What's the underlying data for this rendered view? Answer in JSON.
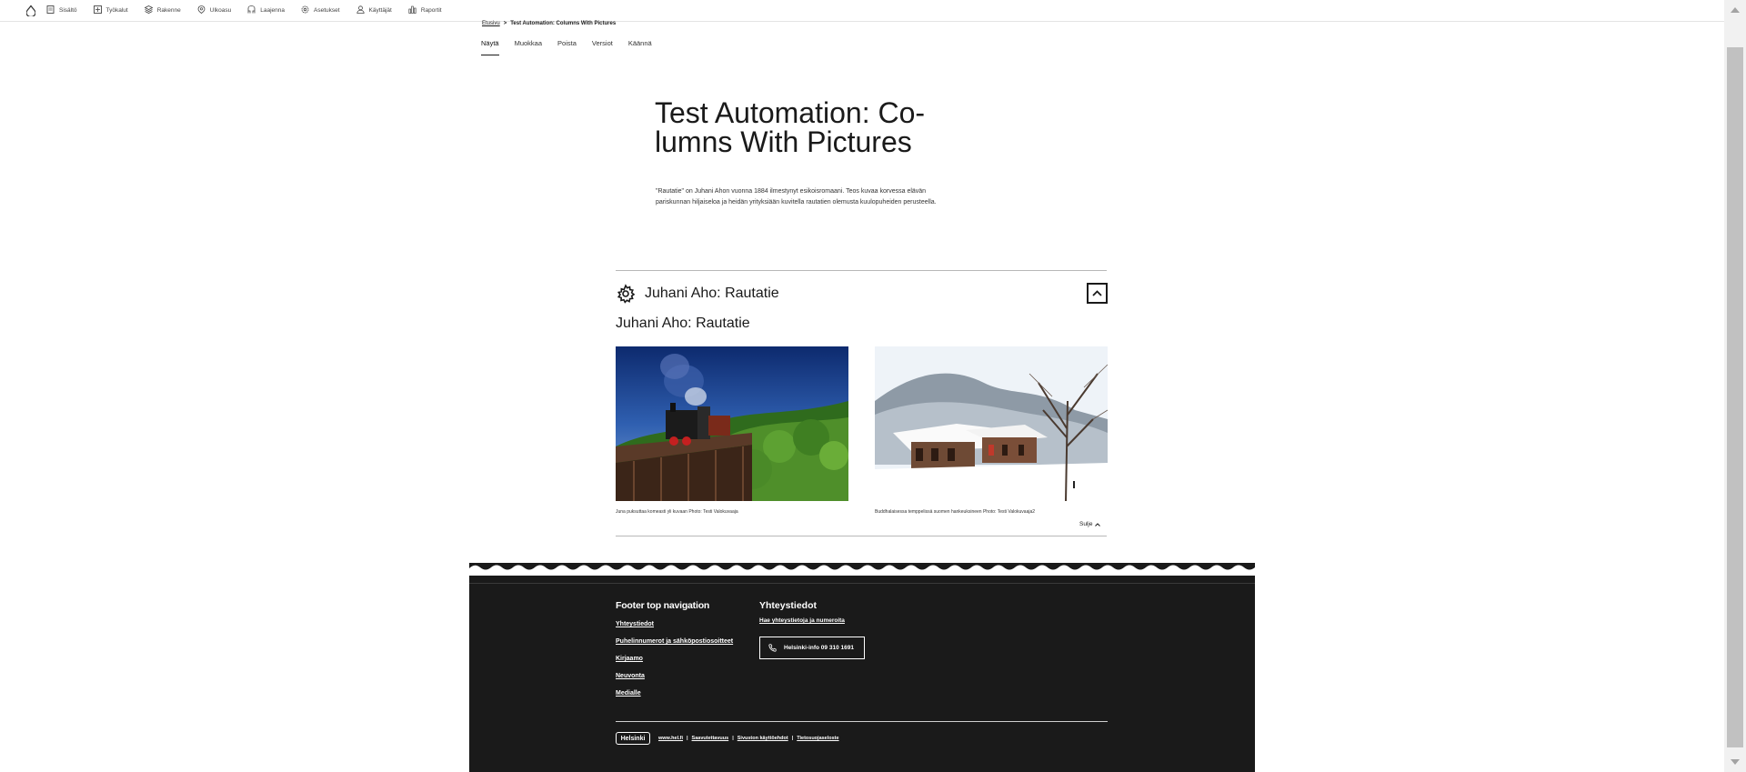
{
  "toolbar": {
    "items": [
      {
        "label": "Sisältö",
        "icon": "document-icon"
      },
      {
        "label": "Työkalut",
        "icon": "tools-icon"
      },
      {
        "label": "Rakenne",
        "icon": "structure-icon"
      },
      {
        "label": "Ulkoasu",
        "icon": "appearance-icon"
      },
      {
        "label": "Laajenna",
        "icon": "extend-icon"
      },
      {
        "label": "Asetukset",
        "icon": "settings-icon"
      },
      {
        "label": "Käyttäjät",
        "icon": "user-icon"
      },
      {
        "label": "Raportit",
        "icon": "reports-icon"
      }
    ]
  },
  "breadcrumb": {
    "home": "Etusivu",
    "separator": ">",
    "current": "Test Automation: Columns With Pictures"
  },
  "tabs": [
    {
      "label": "Näytä",
      "active": true
    },
    {
      "label": "Muokkaa",
      "active": false
    },
    {
      "label": "Poista",
      "active": false
    },
    {
      "label": "Versiot",
      "active": false
    },
    {
      "label": "Käännä",
      "active": false
    }
  ],
  "page": {
    "title_line1": "Test Automation: Co-",
    "title_line2": "lumns With Pictures",
    "lead": "\"Rautatie\" on Juhani Ahon vuonna 1884 ilmestynyt esikoisromaani. Teos kuvaa korvessa elävän pariskunnan hiljaiseloa ja heidän yrityksiään kuvitella rautatien olemusta kuulopuheiden perusteella."
  },
  "accordion": {
    "title": "Juhani Aho: Rautatie",
    "subtitle": "Juhani Aho: Rautatie",
    "captions": [
      "Juna puksuttaa komeasti yli kuvaan Photo: Testi Valokuvaaja",
      "Buddhalaisessa temppelissä suomen hankeuksineen Photo: Testi Valokuvaaja2"
    ],
    "close_label": "Sulje"
  },
  "footer": {
    "nav_heading": "Footer top navigation",
    "nav_items": [
      "Yhteystiedot",
      "Puhelinnumerot ja sähköpostiosoitteet",
      "Kirjaamo",
      "Neuvonta",
      "Medialle"
    ],
    "contact_heading": "Yhteystiedot",
    "contact_link": "Hae yhteystietoja ja numeroita",
    "contact_button": "Helsinki-info 09 310 1691",
    "logo": "Helsinki",
    "bottom_links": [
      "www.hel.fi",
      "Saavutettavuus",
      "Sivuston käyttöehdot",
      "Tietosuojaseloste"
    ]
  },
  "colors": {
    "footer_bg": "#1a1a1a",
    "text": "#1a1a1a",
    "divider": "#b8b8b8"
  }
}
